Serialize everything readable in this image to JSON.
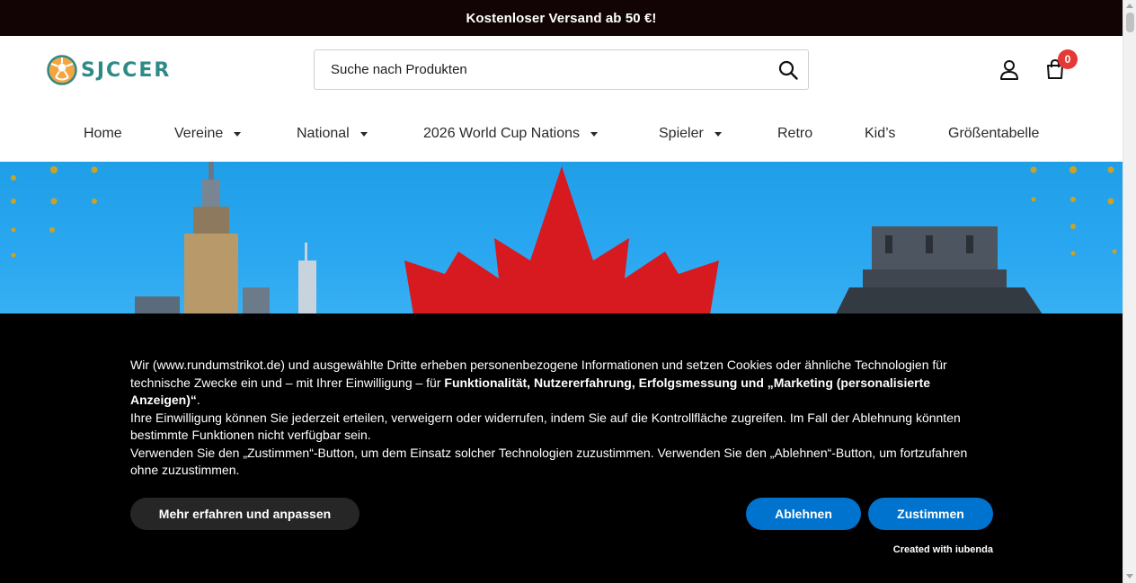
{
  "announcement": {
    "text": "Kostenloser Versand ab 50 €!"
  },
  "header": {
    "logo_text": "SJCCER",
    "search": {
      "placeholder": "Suche nach Produkten"
    },
    "cart_count": "0"
  },
  "nav": {
    "items": [
      {
        "label": "Home",
        "has_dropdown": false
      },
      {
        "label": "Vereine",
        "has_dropdown": true
      },
      {
        "label": "National",
        "has_dropdown": true
      },
      {
        "label": "2026 World Cup Nations",
        "has_dropdown": true
      },
      {
        "label": "Spieler",
        "has_dropdown": true
      },
      {
        "label": "Retro",
        "has_dropdown": false
      },
      {
        "label": "Kid’s",
        "has_dropdown": false
      },
      {
        "label": "Größentabelle",
        "has_dropdown": false
      }
    ]
  },
  "cookie": {
    "p1_start": "Wir (www.rundumstrikot.de) und ausgewählte Dritte erheben personenbezogene Informationen und setzen Cookies oder ähnliche Technologien für technische Zwecke ein und – mit Ihrer Einwilligung – für ",
    "p1_bold": "Funktionalität, Nutzererfahrung, Erfolgsmessung und „Marketing (personalisierte Anzeigen)“",
    "p1_end": ".",
    "p2": "Ihre Einwilligung können Sie jederzeit erteilen, verweigern oder widerrufen, indem Sie auf die Kontrollfläche zugreifen. Im Fall der Ablehnung könnten bestimmte Funktionen nicht verfügbar sein.",
    "p3": "Verwenden Sie den „Zustimmen“-Button, um dem Einsatz solcher Technologien zuzustimmen. Verwenden Sie den „Ablehnen“-Button, um fortzufahren ohne zuzustimmen.",
    "more_button": "Mehr erfahren und anpassen",
    "reject_button": "Ablehnen",
    "accept_button": "Zustimmen",
    "created_with": "Created with iubenda"
  },
  "colors": {
    "announcement_bg": "#120404",
    "brand": "#2d8a86",
    "cookie_bg": "#000000",
    "primary_button": "#0073ce",
    "secondary_button": "#262626",
    "badge": "#e53935",
    "hero_sky": "#2aa7f0"
  },
  "icons": {
    "logo": "soccer-ball-icon",
    "search": "search-icon",
    "account": "user-icon",
    "cart": "shopping-bag-icon",
    "dropdown": "caret-down-icon"
  }
}
